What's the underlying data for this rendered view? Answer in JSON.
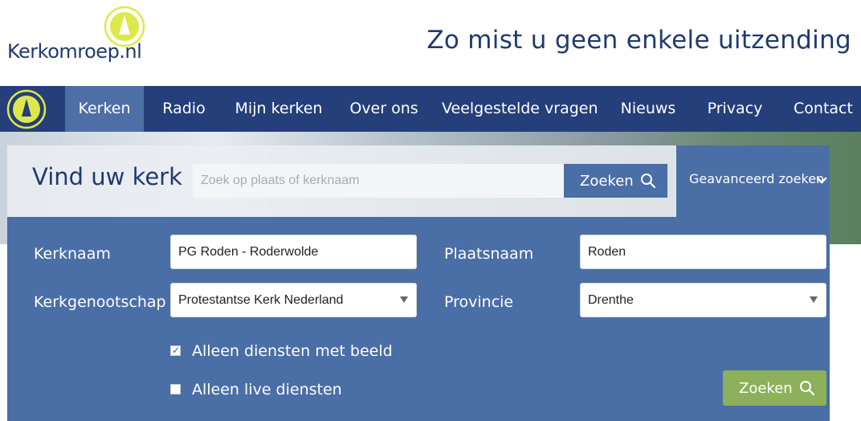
{
  "brand": {
    "name": "Kerkomroep.nl",
    "tagline": "Zo mist u geen enkele uitzending",
    "accent": "#dfe84a",
    "navy": "#243f7a"
  },
  "nav": {
    "items": [
      {
        "label": "Kerken",
        "active": true
      },
      {
        "label": "Radio",
        "active": false
      },
      {
        "label": "Mijn kerken",
        "active": false
      },
      {
        "label": "Over ons",
        "active": false
      },
      {
        "label": "Veelgestelde vragen",
        "active": false
      },
      {
        "label": "Nieuws",
        "active": false
      },
      {
        "label": "Privacy",
        "active": false
      },
      {
        "label": "Contact",
        "active": false
      }
    ]
  },
  "search": {
    "title": "Vind uw kerk",
    "placeholder": "Zoek op plaats of kerknaam",
    "value": "",
    "button_label": "Zoeken",
    "advanced_label": "Geavanceerd zoeken"
  },
  "advanced": {
    "kerknaam_label": "Kerknaam",
    "kerknaam_value": "PG Roden - Roderwolde",
    "plaatsnaam_label": "Plaatsnaam",
    "plaatsnaam_value": "Roden",
    "kerkgenootschap_label": "Kerkgenootschap",
    "kerkgenootschap_value": "Protestantse Kerk Nederland",
    "provincie_label": "Provincie",
    "provincie_value": "Drenthe",
    "checkbox_beeld": {
      "label": "Alleen diensten met beeld",
      "checked": true
    },
    "checkbox_live": {
      "label": "Alleen live diensten",
      "checked": false
    },
    "submit_label": "Zoeken",
    "submit_color": "#8db05a"
  }
}
